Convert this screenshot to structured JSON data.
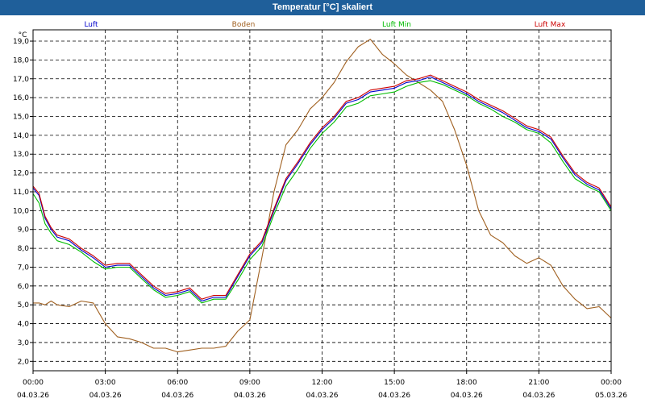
{
  "window": {
    "title": "Temperatur [°C] skaliert"
  },
  "chart_data": {
    "type": "line",
    "unit": "°C",
    "ylim": [
      1.5,
      19.6
    ],
    "y_ticks": [
      "2,0",
      "3,0",
      "4,0",
      "5,0",
      "6,0",
      "7,0",
      "8,0",
      "9,0",
      "10,0",
      "11,0",
      "12,0",
      "13,0",
      "14,0",
      "15,0",
      "16,0",
      "17,0",
      "18,0",
      "19,0"
    ],
    "y_tick_values": [
      2,
      3,
      4,
      5,
      6,
      7,
      8,
      9,
      10,
      11,
      12,
      13,
      14,
      15,
      16,
      17,
      18,
      19
    ],
    "x_range_hours": [
      0,
      24
    ],
    "x_ticks": [
      {
        "time": "00:00",
        "date": "04.03.26",
        "hour": 0
      },
      {
        "time": "03:00",
        "date": "04.03.26",
        "hour": 3
      },
      {
        "time": "06:00",
        "date": "04.03.26",
        "hour": 6
      },
      {
        "time": "09:00",
        "date": "04.03.26",
        "hour": 9
      },
      {
        "time": "12:00",
        "date": "04.03.26",
        "hour": 12
      },
      {
        "time": "15:00",
        "date": "04.03.26",
        "hour": 15
      },
      {
        "time": "18:00",
        "date": "04.03.26",
        "hour": 18
      },
      {
        "time": "21:00",
        "date": "04.03.26",
        "hour": 21
      },
      {
        "time": "00:00",
        "date": "05.03.26",
        "hour": 24
      }
    ],
    "grid": true,
    "legend_position": "top",
    "series": [
      {
        "name": "Luft",
        "color": "#0000cc",
        "x": [
          0,
          0.25,
          0.5,
          0.75,
          1,
          1.5,
          2,
          2.5,
          3,
          3.5,
          4,
          4.5,
          5,
          5.5,
          6,
          6.5,
          7,
          7.5,
          8,
          8.5,
          9,
          9.5,
          10,
          10.5,
          11,
          11.5,
          12,
          12.5,
          13,
          13.5,
          14,
          14.5,
          15,
          15.5,
          16,
          16.5,
          17,
          17.5,
          18,
          18.5,
          19,
          19.5,
          20,
          20.5,
          21,
          21.5,
          22,
          22.5,
          23,
          23.5,
          24
        ],
        "y": [
          11.2,
          10.8,
          9.6,
          9.0,
          8.6,
          8.4,
          7.9,
          7.5,
          7.0,
          7.1,
          7.1,
          6.5,
          5.9,
          5.5,
          5.6,
          5.8,
          5.2,
          5.4,
          5.4,
          6.5,
          7.6,
          8.3,
          10.0,
          11.6,
          12.5,
          13.5,
          14.3,
          14.9,
          15.7,
          15.9,
          16.3,
          16.4,
          16.5,
          16.8,
          16.9,
          17.1,
          16.8,
          16.5,
          16.2,
          15.8,
          15.5,
          15.2,
          14.8,
          14.4,
          14.2,
          13.8,
          12.8,
          11.9,
          11.4,
          11.1,
          10.1
        ]
      },
      {
        "name": "Boden",
        "color": "#a06020",
        "x": [
          0,
          0.25,
          0.5,
          0.75,
          1,
          1.5,
          2,
          2.5,
          3,
          3.5,
          4,
          4.5,
          5,
          5.5,
          6,
          6.5,
          7,
          7.5,
          8,
          8.5,
          9,
          9.5,
          10,
          10.5,
          11,
          11.5,
          12,
          12.5,
          13,
          13.5,
          14,
          14.5,
          15,
          15.5,
          16,
          16.5,
          17,
          17.5,
          18,
          18.5,
          19,
          19.5,
          20,
          20.5,
          21,
          21.5,
          22,
          22.5,
          23,
          23.5,
          24
        ],
        "y": [
          5.1,
          5.1,
          5.0,
          5.2,
          5.0,
          4.9,
          5.2,
          5.1,
          4.0,
          3.3,
          3.2,
          3.0,
          2.7,
          2.7,
          2.5,
          2.6,
          2.7,
          2.7,
          2.8,
          3.6,
          4.2,
          7.5,
          11.0,
          13.5,
          14.3,
          15.4,
          16.0,
          16.8,
          17.9,
          18.7,
          19.1,
          18.3,
          17.8,
          17.2,
          16.8,
          16.4,
          15.8,
          14.3,
          12.4,
          10.0,
          8.7,
          8.3,
          7.6,
          7.2,
          7.5,
          7.1,
          6.0,
          5.3,
          4.8,
          4.9,
          4.3
        ]
      },
      {
        "name": "Luft Min",
        "color": "#00bb00",
        "x": [
          0,
          0.25,
          0.5,
          0.75,
          1,
          1.5,
          2,
          2.5,
          3,
          3.5,
          4,
          4.5,
          5,
          5.5,
          6,
          6.5,
          7,
          7.5,
          8,
          8.5,
          9,
          9.5,
          10,
          10.5,
          11,
          11.5,
          12,
          12.5,
          13,
          13.5,
          14,
          14.5,
          15,
          15.5,
          16,
          16.5,
          17,
          17.5,
          18,
          18.5,
          19,
          19.5,
          20,
          20.5,
          21,
          21.5,
          22,
          22.5,
          23,
          23.5,
          24
        ],
        "y": [
          10.9,
          10.4,
          9.3,
          8.8,
          8.4,
          8.2,
          7.8,
          7.3,
          6.9,
          7.0,
          7.0,
          6.4,
          5.8,
          5.4,
          5.5,
          5.7,
          5.1,
          5.3,
          5.3,
          6.3,
          7.4,
          8.1,
          9.8,
          11.3,
          12.2,
          13.3,
          14.1,
          14.7,
          15.5,
          15.7,
          16.1,
          16.2,
          16.3,
          16.6,
          16.8,
          16.9,
          16.7,
          16.4,
          16.1,
          15.7,
          15.4,
          15.0,
          14.7,
          14.3,
          14.1,
          13.6,
          12.6,
          11.7,
          11.3,
          11.0,
          10.0
        ]
      },
      {
        "name": "Luft Max",
        "color": "#cc0000",
        "x": [
          0,
          0.25,
          0.5,
          0.75,
          1,
          1.5,
          2,
          2.5,
          3,
          3.5,
          4,
          4.5,
          5,
          5.5,
          6,
          6.5,
          7,
          7.5,
          8,
          8.5,
          9,
          9.5,
          10,
          10.5,
          11,
          11.5,
          12,
          12.5,
          13,
          13.5,
          14,
          14.5,
          15,
          15.5,
          16,
          16.5,
          17,
          17.5,
          18,
          18.5,
          19,
          19.5,
          20,
          20.5,
          21,
          21.5,
          22,
          22.5,
          23,
          23.5,
          24
        ],
        "y": [
          11.3,
          10.9,
          9.7,
          9.1,
          8.7,
          8.5,
          8.0,
          7.6,
          7.1,
          7.2,
          7.2,
          6.6,
          6.0,
          5.6,
          5.7,
          5.9,
          5.3,
          5.5,
          5.5,
          6.6,
          7.7,
          8.4,
          10.1,
          11.7,
          12.6,
          13.6,
          14.4,
          15.0,
          15.8,
          16.0,
          16.4,
          16.5,
          16.6,
          16.9,
          17.0,
          17.2,
          16.9,
          16.6,
          16.3,
          15.9,
          15.6,
          15.3,
          14.9,
          14.5,
          14.3,
          13.9,
          12.9,
          12.0,
          11.5,
          11.2,
          10.2
        ]
      }
    ]
  }
}
